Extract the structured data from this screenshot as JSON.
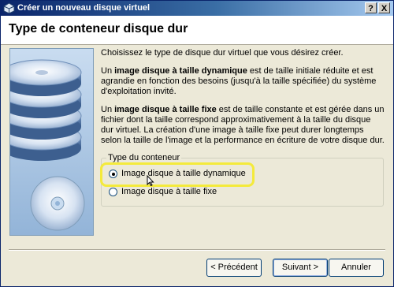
{
  "window": {
    "title": "Créer un nouveau disque virtuel",
    "help_button": "?",
    "close_button": "X"
  },
  "header": {
    "heading": "Type de conteneur disque dur"
  },
  "content": {
    "intro": "Choisissez le type de disque dur virtuel que vous désirez créer.",
    "dynamic_desc_bold": "image disque à taille dynamique",
    "dynamic_desc_pre": "Un ",
    "dynamic_desc_rest": " est de taille initiale réduite et est agrandie en fonction des besoins (jusqu'à la taille spécifiée) du système d'exploitation invité.",
    "fixed_desc_pre": "Un ",
    "fixed_desc_bold": "image disque à taille fixe",
    "fixed_desc_rest": " est de taille constante et est gérée dans un fichier dont la taille correspond approximativement à la taille du disque dur virtuel. La création d'une image à taille fixe peut durer longtemps selon la taille de l'image et la performance en écriture de votre disque dur."
  },
  "group": {
    "legend": "Type du conteneur",
    "options": [
      {
        "label": "Image disque à taille dynamique",
        "selected": true
      },
      {
        "label": "Image disque à taille fixe",
        "selected": false
      }
    ]
  },
  "buttons": {
    "prev": "< Précédent",
    "next": "Suivant >",
    "cancel": "Annuler"
  },
  "colors": {
    "accent_highlight": "#f4ea3b",
    "titlebar": "#0a246a"
  },
  "icons": {
    "app": "virtualbox-icon",
    "art": "disk-stack-icon",
    "cursor": "mouse-cursor-icon"
  }
}
